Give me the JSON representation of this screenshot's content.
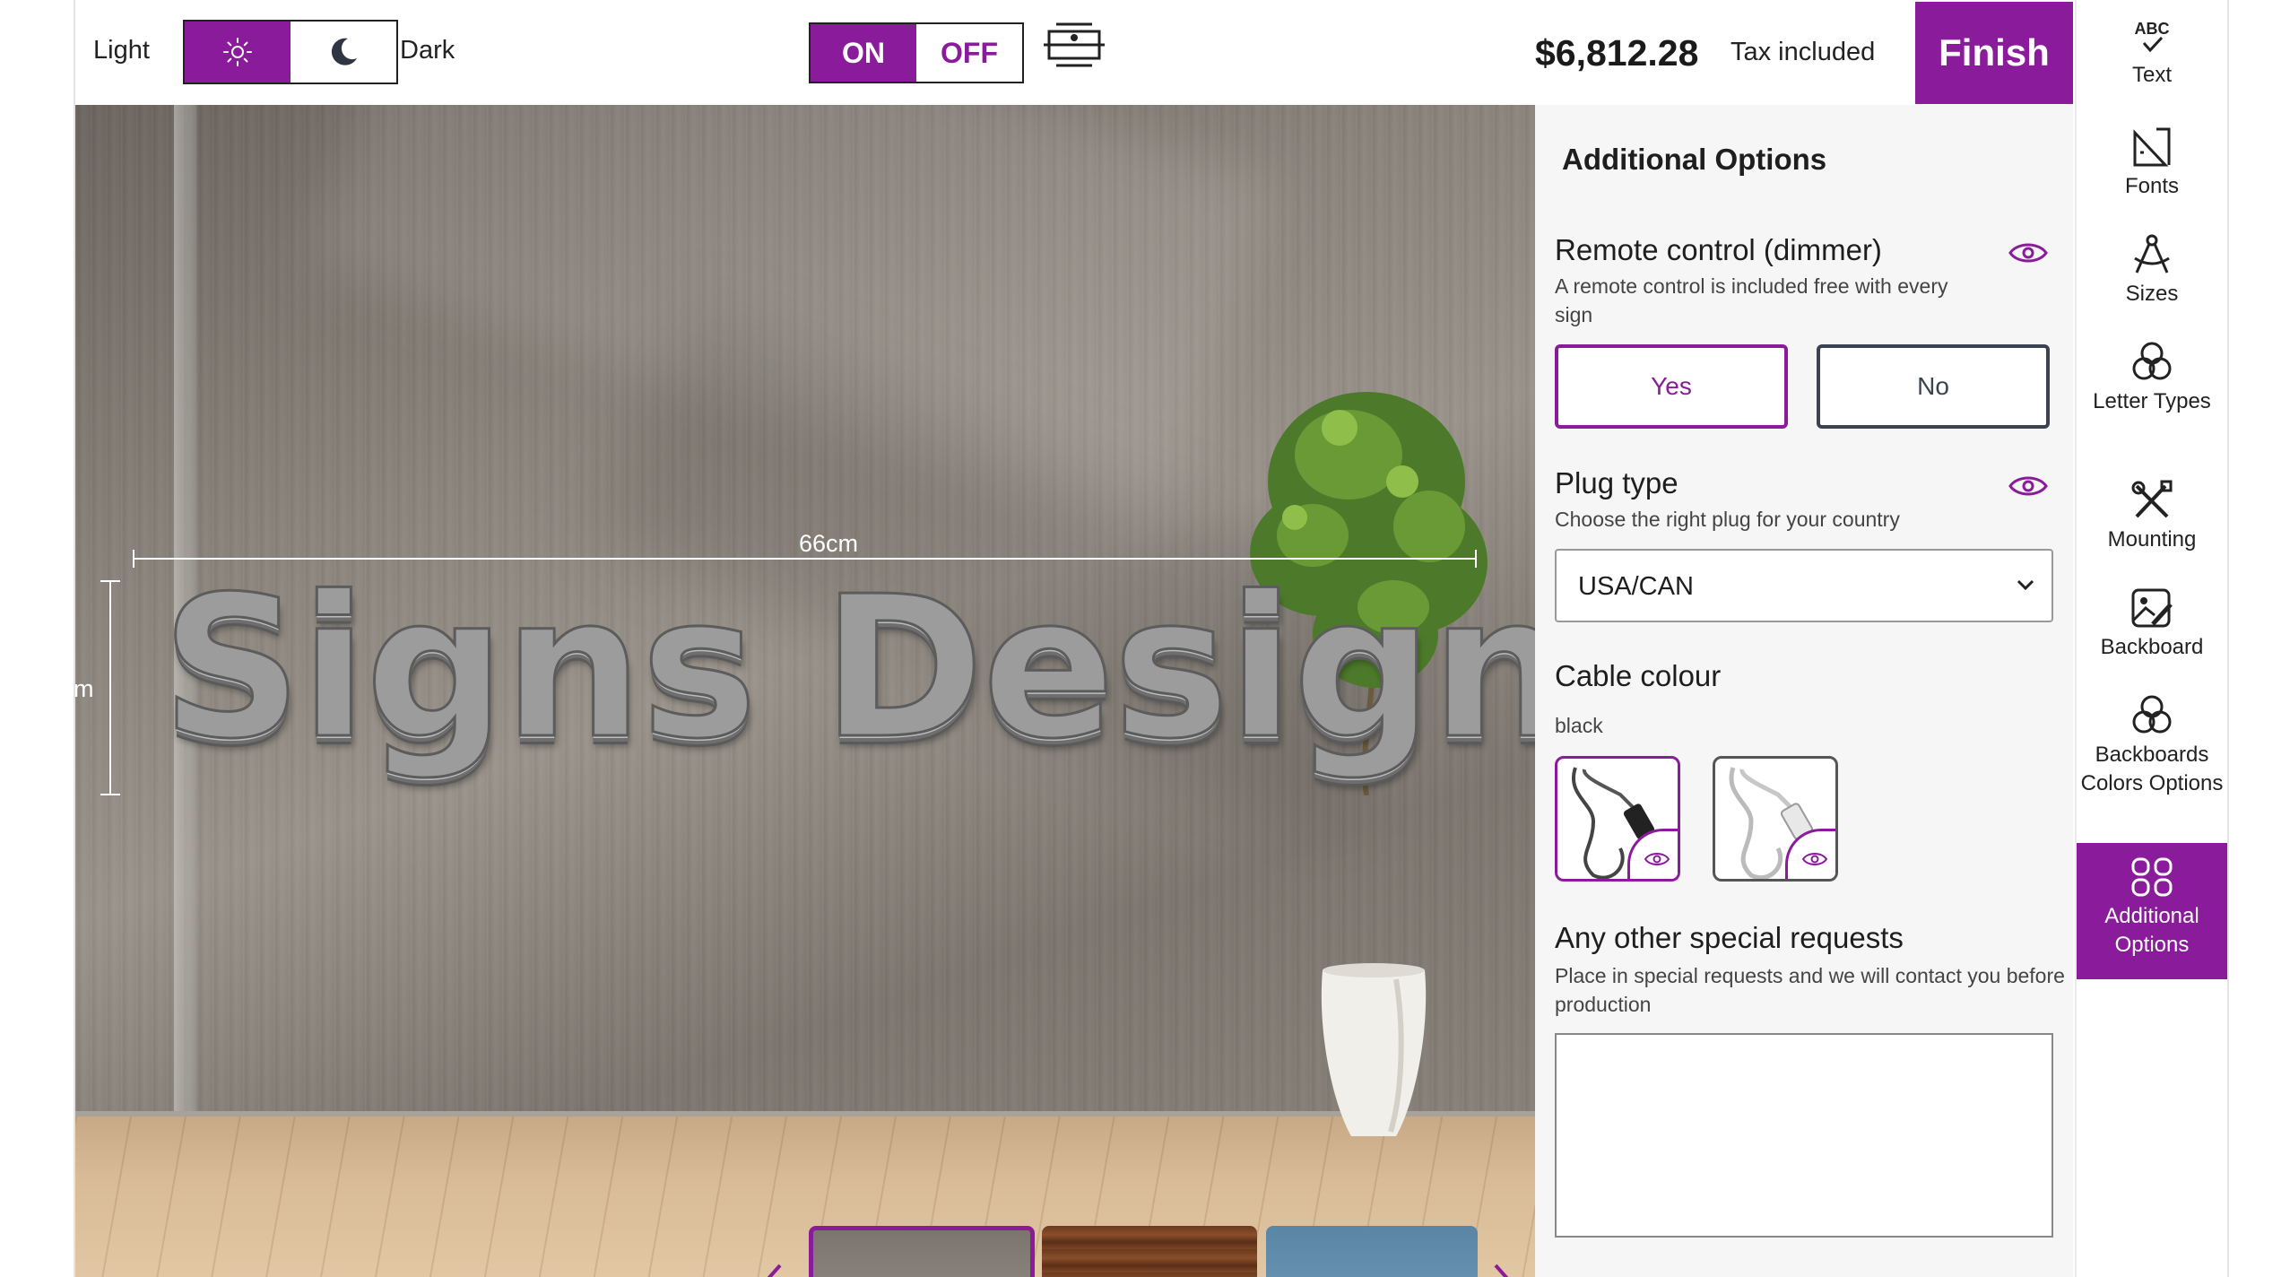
{
  "topbar": {
    "light_label": "Light",
    "dark_label": "Dark",
    "power_on": "ON",
    "power_off": "OFF",
    "price": "$6,812.28",
    "tax_note": "Tax included",
    "finish_label": "Finish"
  },
  "preview": {
    "sign_text": "Signs Designer",
    "width_label": "66cm",
    "height_label": "m"
  },
  "panel": {
    "title": "Additional Options",
    "remote": {
      "title": "Remote control (dimmer)",
      "desc": "A remote control is included free with every sign",
      "yes": "Yes",
      "no": "No"
    },
    "plug": {
      "title": "Plug type",
      "desc": "Choose the right plug for your country",
      "selected": "USA/CAN"
    },
    "cable": {
      "title": "Cable colour",
      "selected": "black"
    },
    "requests": {
      "title": "Any other special requests",
      "desc": "Place in special requests and we will contact you before production"
    }
  },
  "sidebar": {
    "items": [
      {
        "label": "Text",
        "icon": "abc-check-icon"
      },
      {
        "label": "Fonts",
        "icon": "fonts-icon"
      },
      {
        "label": "Sizes",
        "icon": "compass-icon"
      },
      {
        "label": "Letter Types",
        "icon": "circles-icon"
      },
      {
        "label": "Mounting",
        "icon": "tools-icon"
      },
      {
        "label": "Backboard",
        "icon": "image-edit-icon"
      },
      {
        "label": "Backboards Colors Options",
        "icon": "circles-icon"
      },
      {
        "label": "Additional Options",
        "icon": "grid-icon"
      }
    ]
  },
  "colors": {
    "accent": "#8a1c9c"
  }
}
